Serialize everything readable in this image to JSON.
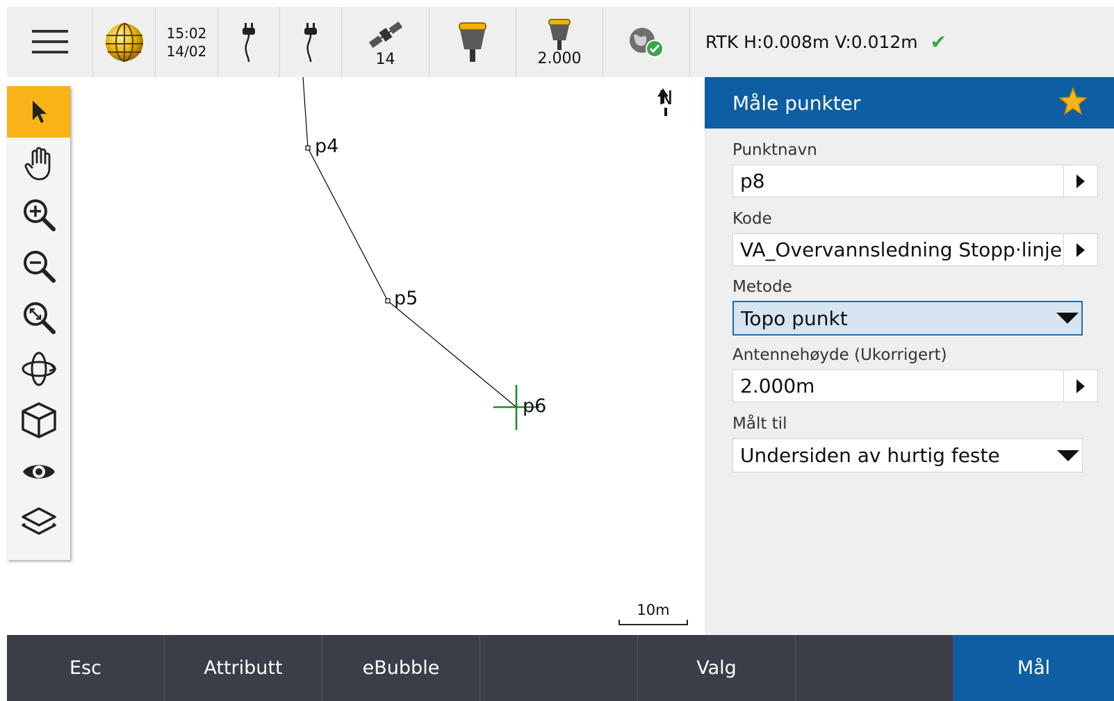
{
  "status_bar": {
    "time": "15:02",
    "date": "14/02",
    "satellites": "14",
    "antenna_height": "2.000",
    "rtk_precision": "RTK H:0.008m V:0.012m",
    "icons": [
      "menu-icon",
      "globe-icon",
      "power-plug-icon",
      "power-plug-icon",
      "satellite-icon",
      "gnss-receiver-icon",
      "receiver-height-icon",
      "internet-connected-icon",
      "check-icon"
    ]
  },
  "map": {
    "points": [
      "p4",
      "p5",
      "p6"
    ],
    "north_label": "N",
    "scale_label": "10m",
    "line_color": "#000000",
    "cursor_color": "#1a8a2a"
  },
  "toolbar": {
    "active_tool": "select",
    "tools": [
      "select",
      "pan",
      "zoom-in",
      "zoom-out",
      "zoom-extents",
      "orbit",
      "3d-view",
      "view-filter",
      "layers"
    ],
    "active_color": "#f8b318"
  },
  "panel": {
    "title": "Måle punkter",
    "header_color": "#0d5ea2",
    "fields": {
      "point_name": {
        "label": "Punktnavn",
        "value": "p8"
      },
      "code": {
        "label": "Kode",
        "value": "VA_Overvannsledning Stopp·linje"
      },
      "method": {
        "label": "Metode",
        "value": "Topo punkt"
      },
      "antenna_height": {
        "label": "Antennehøyde (Ukorrigert)",
        "value": "2.000m"
      },
      "measured_to": {
        "label": "Målt til",
        "value": "Undersiden av hurtig feste"
      }
    }
  },
  "softkeys": {
    "esc": "Esc",
    "attribute": "Attributt",
    "ebubble": "eBubble",
    "empty": "",
    "options": "Valg",
    "empty2": "",
    "measure": "Mål"
  }
}
